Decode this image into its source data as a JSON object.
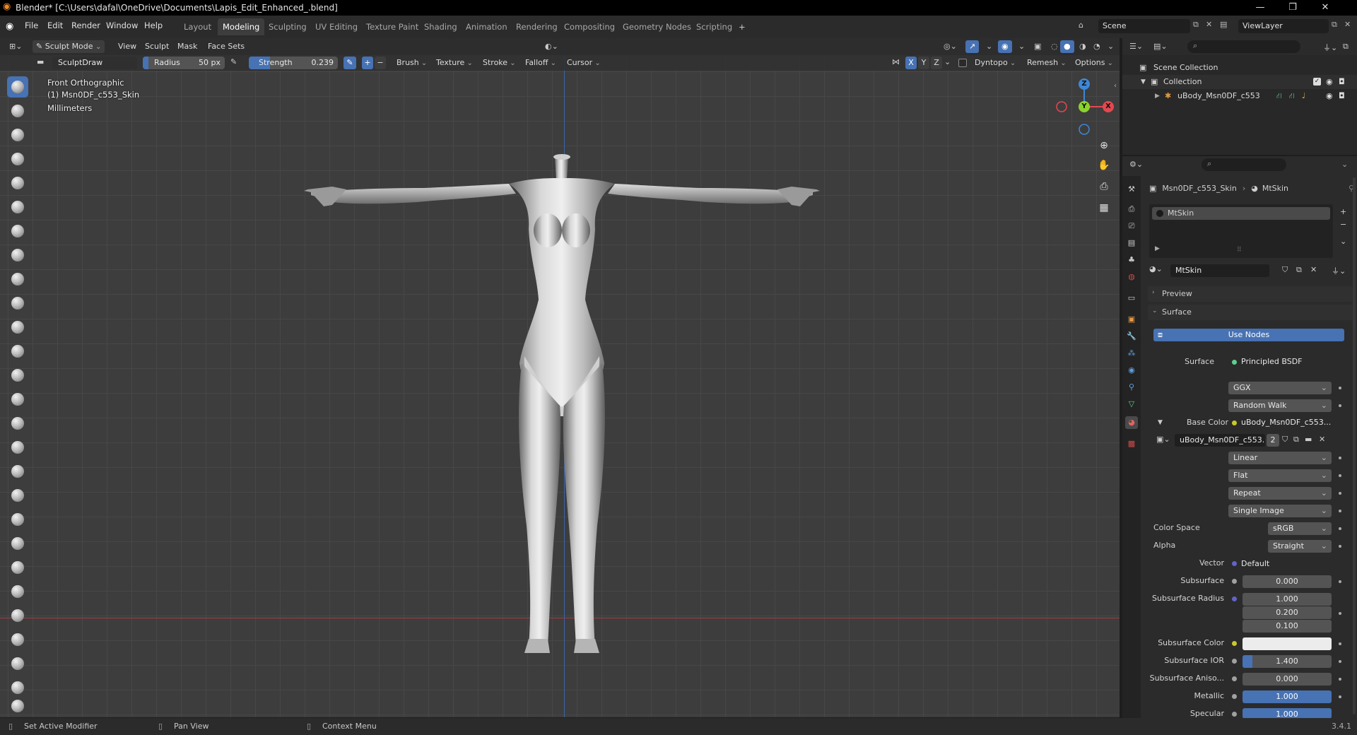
{
  "title_bar": {
    "title": "Blender* [C:\\Users\\dafal\\OneDrive\\Documents\\Lapis_Edit_Enhanced_.blend]",
    "minimize": "—",
    "maximize": "❐",
    "close": "✕"
  },
  "menu": [
    "File",
    "Edit",
    "Render",
    "Window",
    "Help"
  ],
  "workspaces": {
    "tabs": [
      "Layout",
      "Modeling",
      "Sculpting",
      "UV Editing",
      "Texture Paint",
      "Shading",
      "Animation",
      "Rendering",
      "Compositing",
      "Geometry Nodes",
      "Scripting"
    ],
    "active": "Modeling",
    "add": "+"
  },
  "scene": {
    "name": "Scene",
    "view_layer": "ViewLayer"
  },
  "viewport_header": {
    "mode": "Sculpt Mode",
    "menus": [
      "View",
      "Sculpt",
      "Mask",
      "Face Sets"
    ]
  },
  "tool_settings": {
    "brush_name": "SculptDraw",
    "radius_label": "Radius",
    "radius_value": "50 px",
    "strength_label": "Strength",
    "strength_value": "0.239",
    "strength_fraction": 0.239,
    "plus": "+",
    "minus": "−",
    "menus": [
      "Brush",
      "Texture",
      "Stroke",
      "Falloff",
      "Cursor"
    ],
    "axes": [
      "X",
      "Y",
      "Z"
    ],
    "dyntopo": "Dyntopo",
    "remesh": "Remesh",
    "options": "Options"
  },
  "viewport_overlay": {
    "view_name": "Front Orthographic",
    "object_name": "(1) Msn0DF_c553_Skin",
    "units": "Millimeters"
  },
  "gizmo": {
    "z": "Z",
    "y": "Y",
    "x": "X"
  },
  "outliner": {
    "scene_collection": "Scene Collection",
    "collection": "Collection",
    "object": "uBody_Msn0DF_c553"
  },
  "properties": {
    "breadcrumb_object": "Msn0DF_c553_Skin",
    "breadcrumb_material": "MtSkin",
    "slot_name": "MtSkin",
    "material_name": "MtSkin",
    "preview_label": "Preview",
    "surface_label": "Surface",
    "use_nodes": "Use Nodes",
    "surface_field_label": "Surface",
    "surface_shader": "Principled BSDF",
    "distribution": "GGX",
    "subsurface_method": "Random Walk",
    "base_color_label": "Base Color",
    "base_color_value": "uBody_Msn0DF_c553...",
    "image_name": "uBody_Msn0DF_c553...",
    "image_users": "2",
    "interpolation": "Linear",
    "projection": "Flat",
    "extension": "Repeat",
    "source": "Single Image",
    "color_space_label": "Color Space",
    "color_space": "sRGB",
    "alpha_label": "Alpha",
    "alpha": "Straight",
    "vector_label": "Vector",
    "vector": "Default",
    "subsurface_label": "Subsurface",
    "subsurface": "0.000",
    "subsurface_radius_label": "Subsurface Radius",
    "subsurface_radius": [
      "1.000",
      "0.200",
      "0.100"
    ],
    "subsurface_color_label": "Subsurface Color",
    "subsurface_ior_label": "Subsurface IOR",
    "subsurface_ior": "1.400",
    "subsurface_aniso_label": "Subsurface Aniso...",
    "subsurface_aniso": "0.000",
    "metallic_label": "Metallic",
    "metallic": "1.000",
    "specular_label": "Specular",
    "specular": "1.000"
  },
  "status_bar": {
    "left": "Set Active Modifier",
    "middle": "Pan View",
    "right": "Context Menu",
    "version": "3.4.1"
  },
  "colors": {
    "accent_blue": "#4772b3",
    "x_axis": "#e34850",
    "y_axis": "#8ad22c",
    "z_axis": "#3f87d6",
    "brand_orange": "#f08a24"
  }
}
